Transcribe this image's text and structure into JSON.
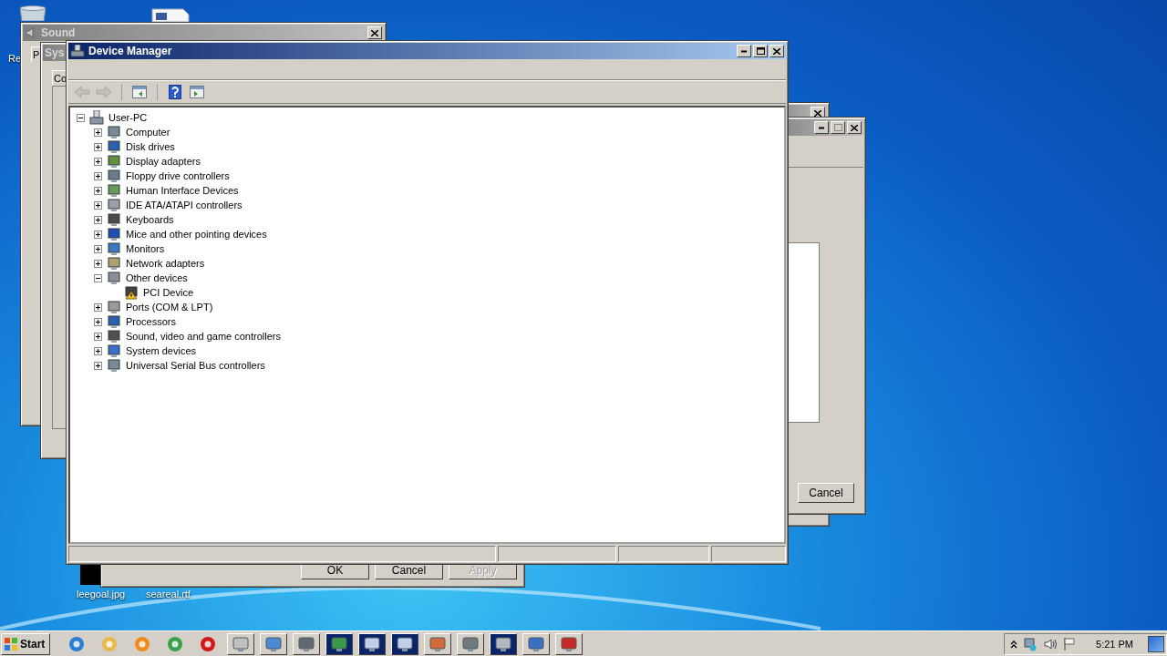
{
  "desktop": {
    "icons": [
      {
        "label": "Re"
      },
      {
        "label": "leegoal.jpg"
      },
      {
        "label": "seareal.rtf"
      }
    ]
  },
  "sound_window": {
    "title": "Sound",
    "tab": "P"
  },
  "system_window": {
    "title": "Sys",
    "tab": "Co"
  },
  "properties_dialog": {
    "buttons": [
      {
        "label": "OK",
        "disabled": false
      },
      {
        "label": "Cancel",
        "disabled": false
      },
      {
        "label": "Apply",
        "disabled": true
      }
    ]
  },
  "right_dialog": {
    "button": "Cancel"
  },
  "device_manager": {
    "title": "Device Manager",
    "toolbar": [
      {
        "kind": "back",
        "disabled": true
      },
      {
        "kind": "forward",
        "disabled": true
      },
      {
        "kind": "tree-toggle",
        "disabled": false
      },
      {
        "kind": "help",
        "disabled": false
      },
      {
        "kind": "properties",
        "disabled": false
      }
    ],
    "tree": {
      "label": "User-PC",
      "expanded": true,
      "warning": false,
      "children": [
        {
          "label": "Computer",
          "expanded": false,
          "warning": false
        },
        {
          "label": "Disk drives",
          "expanded": false,
          "warning": false
        },
        {
          "label": "Display adapters",
          "expanded": false,
          "warning": false
        },
        {
          "label": "Floppy drive controllers",
          "expanded": false,
          "warning": false
        },
        {
          "label": "Human Interface Devices",
          "expanded": false,
          "warning": false
        },
        {
          "label": "IDE ATA/ATAPI controllers",
          "expanded": false,
          "warning": false
        },
        {
          "label": "Keyboards",
          "expanded": false,
          "warning": false
        },
        {
          "label": "Mice and other pointing devices",
          "expanded": false,
          "warning": false
        },
        {
          "label": "Monitors",
          "expanded": false,
          "warning": false
        },
        {
          "label": "Network adapters",
          "expanded": false,
          "warning": false
        },
        {
          "label": "Other devices",
          "expanded": true,
          "warning": false,
          "children": [
            {
              "label": "PCI Device",
              "warning": true
            }
          ]
        },
        {
          "label": "Ports (COM & LPT)",
          "expanded": false,
          "warning": false
        },
        {
          "label": "Processors",
          "expanded": false,
          "warning": false
        },
        {
          "label": "Sound, video and game controllers",
          "expanded": false,
          "warning": false
        },
        {
          "label": "System devices",
          "expanded": false,
          "warning": false
        },
        {
          "label": "Universal Serial Bus controllers",
          "expanded": false,
          "warning": false
        }
      ]
    }
  },
  "taskbar": {
    "start": "Start",
    "clock": "5:21 PM"
  }
}
